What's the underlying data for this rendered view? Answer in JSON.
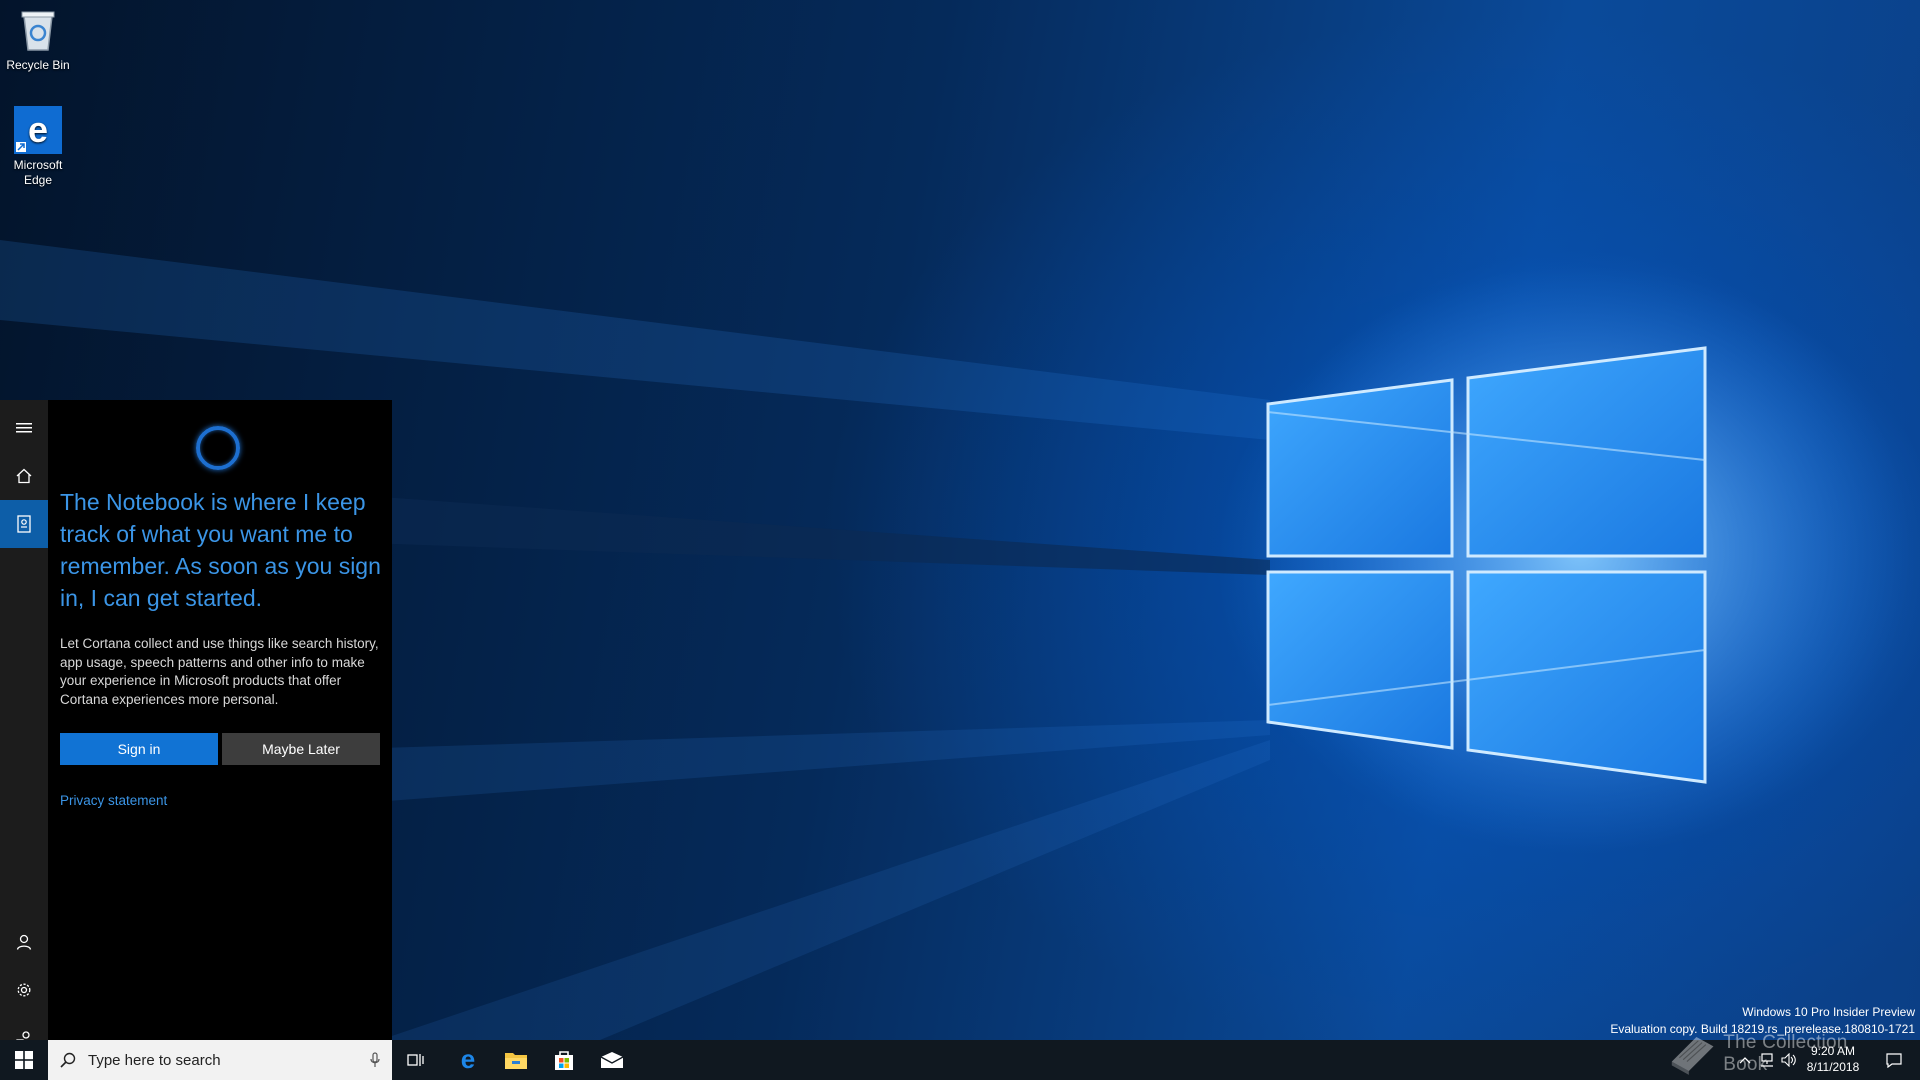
{
  "desktop": {
    "icons": [
      {
        "label": "Recycle Bin"
      },
      {
        "label": "Microsoft Edge"
      }
    ]
  },
  "cortana": {
    "rail": {
      "items": [
        "menu-icon",
        "home-icon",
        "notebook-icon",
        "account-icon",
        "settings-icon",
        "feedback-icon"
      ],
      "active": "notebook-icon"
    },
    "headline": "The Notebook is where I keep track of what you want me to remember. As soon as you sign in, I can get started.",
    "body": "Let Cortana collect and use things like search history, app usage, speech patterns and other info to make your experience in Microsoft products that offer Cortana experiences more personal.",
    "sign_in_label": "Sign in",
    "maybe_later_label": "Maybe Later",
    "privacy_label": "Privacy statement",
    "accent_color": "#3b95e6"
  },
  "taskbar": {
    "search_placeholder": "Type here to search",
    "pinned_apps": [
      "task-view-icon",
      "edge-icon",
      "file-explorer-icon",
      "store-icon",
      "mail-icon"
    ],
    "clock": {
      "time": "9:20 AM",
      "date": "8/11/2018"
    }
  },
  "watermark": {
    "line1": "Windows 10 Pro Insider Preview",
    "line2": "Evaluation copy. Build 18219.rs_prerelease.180810-1721"
  },
  "brand": {
    "text": "The Collection Book"
  }
}
